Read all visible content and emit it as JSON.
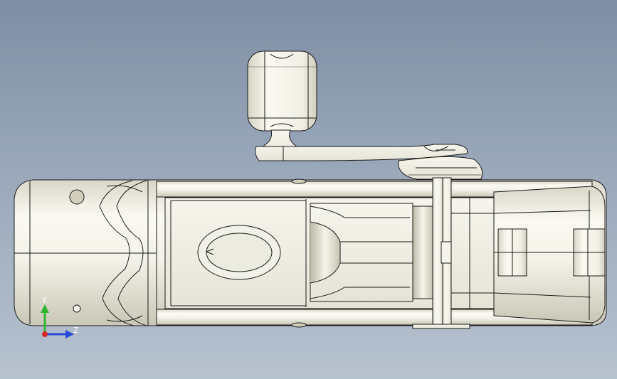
{
  "viewport": {
    "background_top": "#7f8ea3",
    "background_bottom": "#b7c2cf",
    "part_color": "#f1f0e6",
    "edge_color": "#1a1a1a"
  },
  "triad": {
    "y_label": "Y",
    "z_label": "Z",
    "y_color": "#2fb52f",
    "z_color": "#2747d6",
    "x_color": "#d42828"
  }
}
